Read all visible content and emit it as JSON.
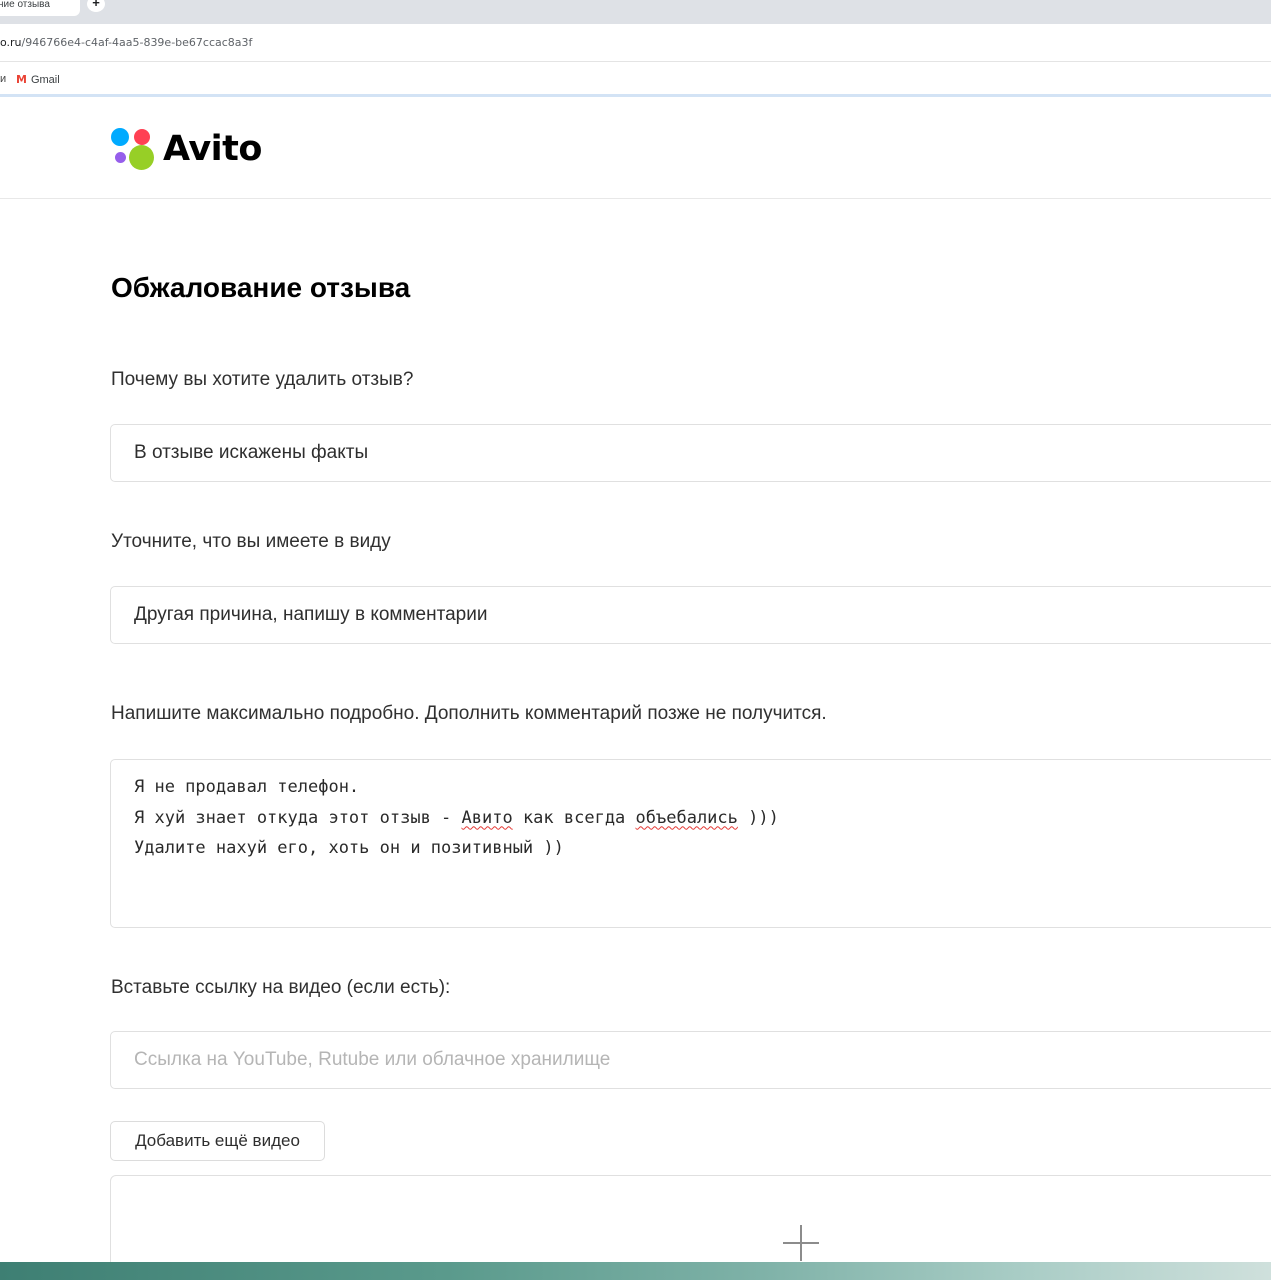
{
  "browser": {
    "tab_title": "ние отзыва",
    "new_tab_glyph": "+",
    "url_host": "o.ru",
    "url_path": "/946766e4-c4af-4aa5-839e-be67ccac8a3f",
    "bookmarks": {
      "left_fragment": "и",
      "gmail_label": "Gmail",
      "gmail_icon_glyph": "M"
    }
  },
  "site": {
    "logo_text": "Avito",
    "logo_colors": [
      "#00aaff",
      "#ff4053",
      "#965eeb",
      "#97cf26"
    ]
  },
  "form": {
    "title": "Обжалование отзыва",
    "reason_label": "Почему вы хотите удалить отзыв?",
    "reason_value": "В отзыве искажены факты",
    "clarify_label": "Уточните, что вы имеете в виду",
    "clarify_value": "Другая причина, напишу в комментарии",
    "comment_label": "Напишите максимально подробно. Дополнить комментарий позже не получится.",
    "comment_lines": {
      "line1": "Я не продавал телефон.",
      "line2_part1": "Я хуй знает откуда этот отзыв - ",
      "line2_word1": "Авито",
      "line2_part2": " как всегда ",
      "line2_word2": "объебались",
      "line2_part3": " )))",
      "line3": "Удалите нахуй его, хоть он и позитивный ))"
    },
    "video_label": "Вставьте ссылку на видео (если есть):",
    "video_placeholder": "Ссылка на YouTube, Rutube или облачное хранилище",
    "add_video_button": "Добавить ещё видео"
  }
}
